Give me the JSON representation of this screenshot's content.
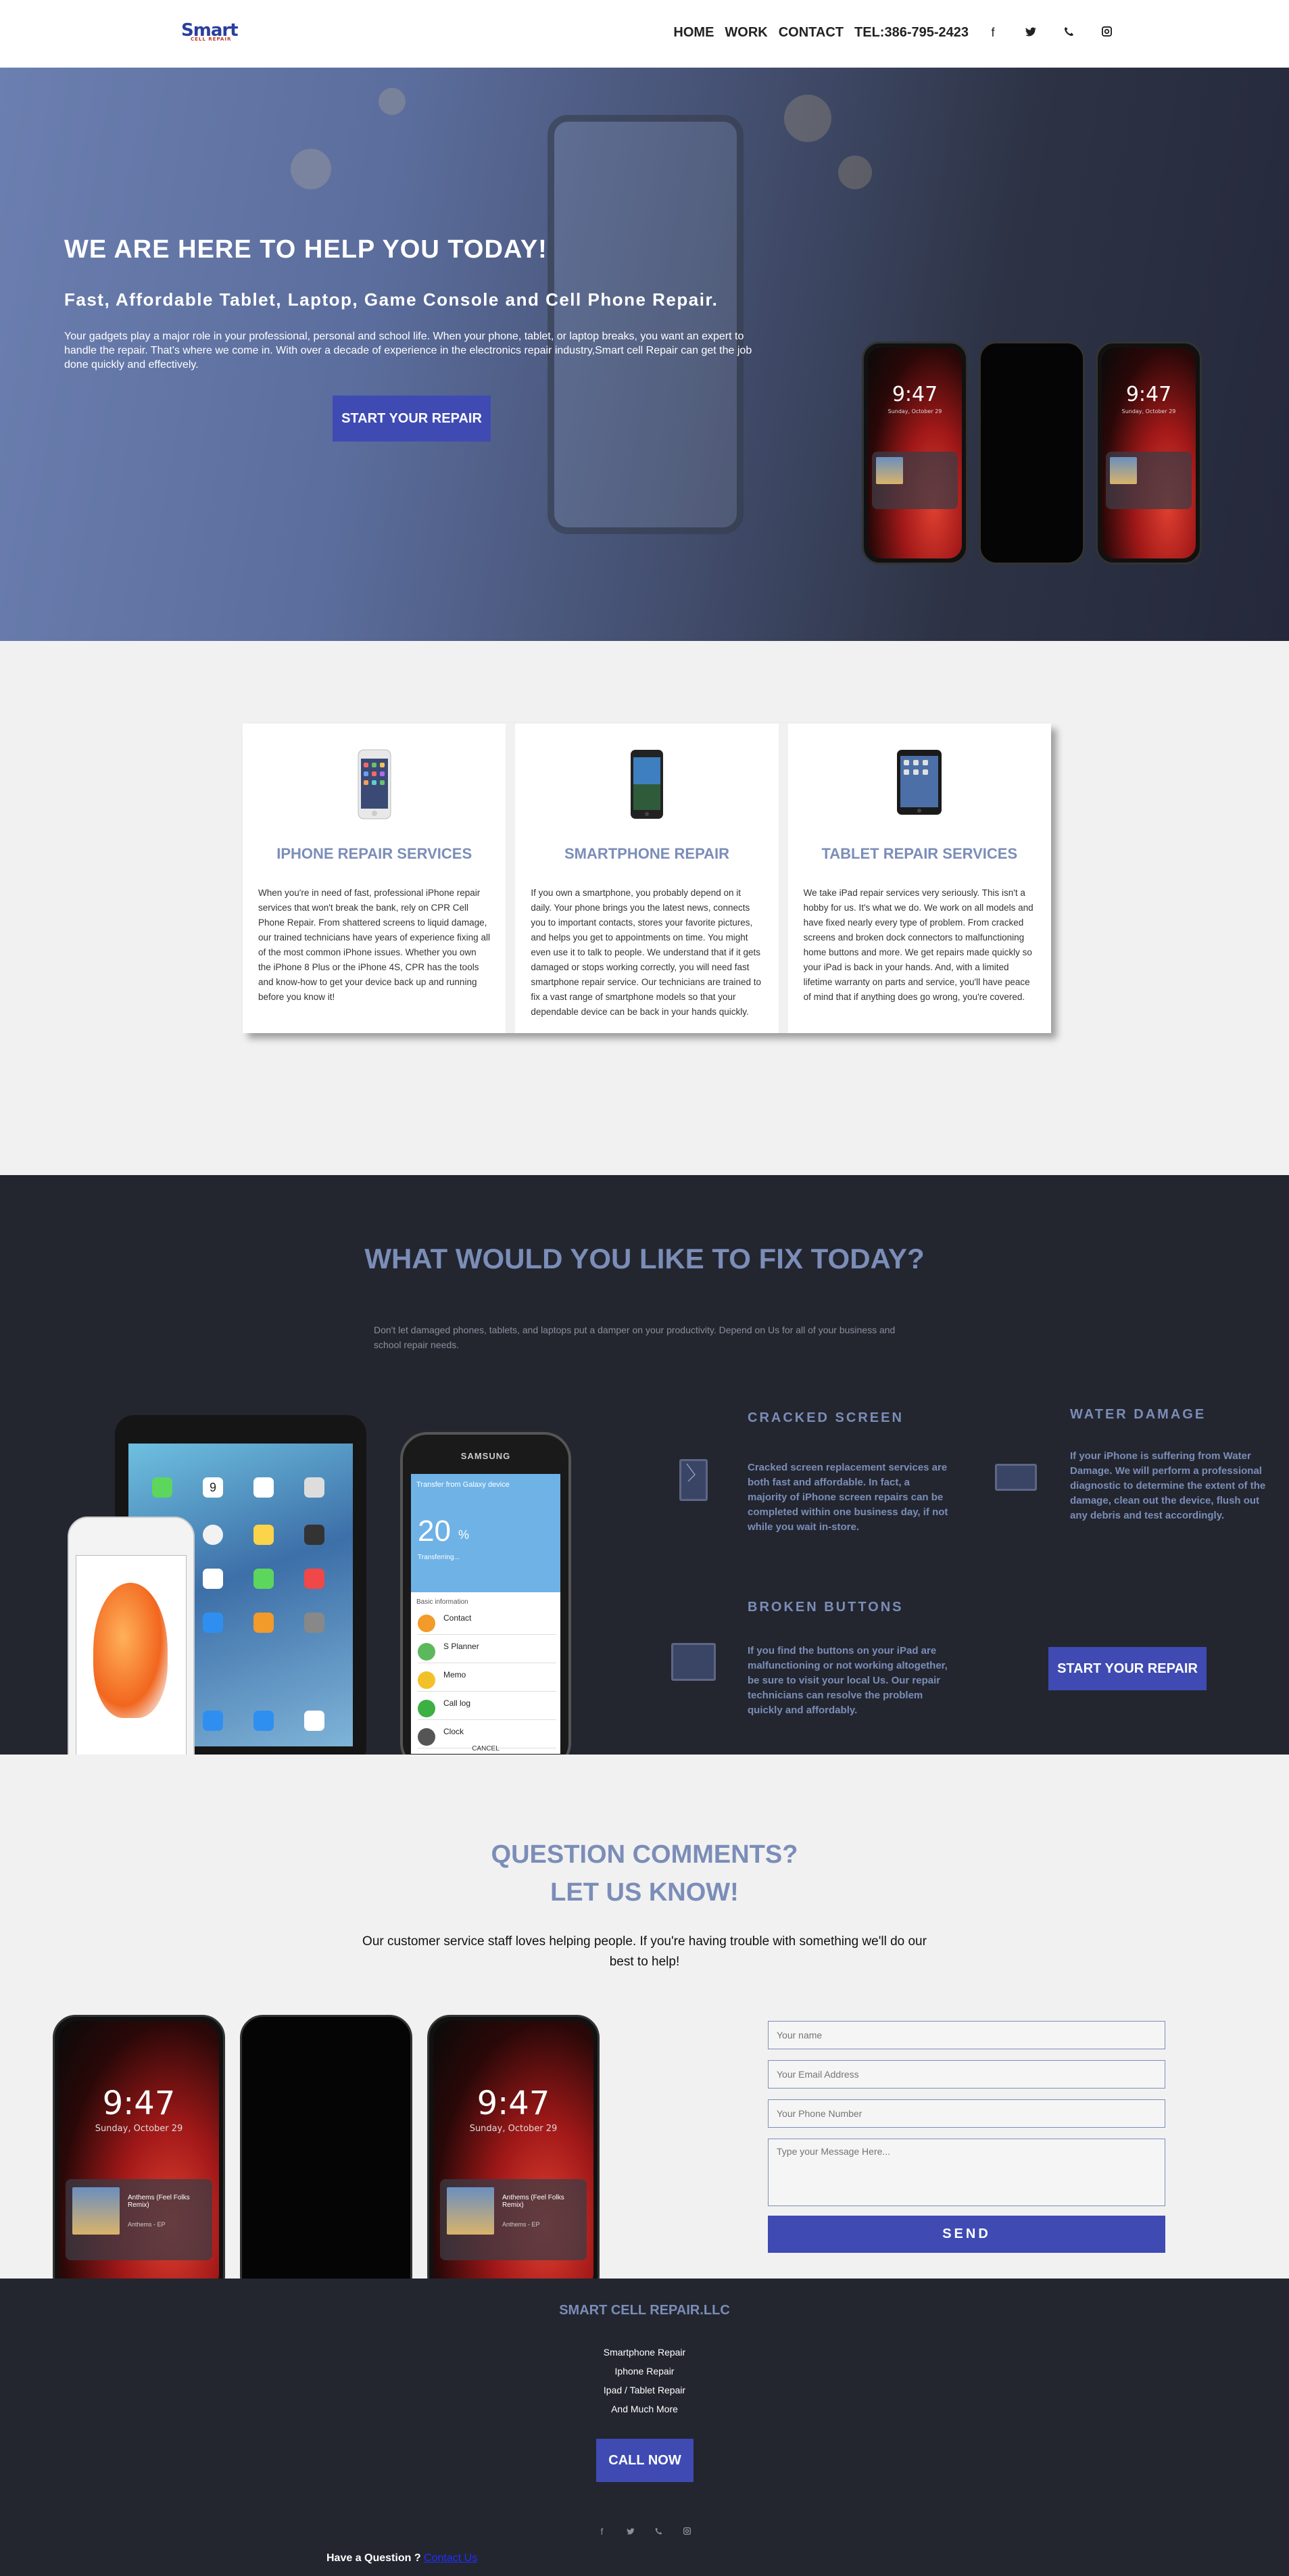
{
  "header": {
    "logo": "Smart",
    "logo_sub": "CELL REPAIR",
    "nav": [
      "HOME",
      "WORK",
      "CONTACT",
      "TEL:386-795-2423"
    ],
    "social_icons": [
      "facebook-icon",
      "twitter-icon",
      "phone-icon",
      "instagram-icon"
    ]
  },
  "hero": {
    "title": "WE ARE HERE TO HELP YOU TODAY!",
    "subtitle": "Fast, Affordable Tablet, Laptop, Game Console and Cell Phone Repair.",
    "text": "Your gadgets play a major role in your professional, personal and school life. When your phone, tablet, or laptop breaks, you want an expert to handle the repair. That's where we come in. With over a decade of experience in the electronics repair industry,Smart cell Repair can get the job done quickly and effectively.",
    "cta": "START YOUR REPAIR",
    "phone_time": "9:47",
    "phone_date": "Sunday, October 29"
  },
  "services": [
    {
      "title": "IPHONE REPAIR SERVICES",
      "icon": "iphone-icon",
      "text": "When you're in need of fast, professional iPhone repair services that won't break the bank, rely on CPR Cell Phone Repair. From shattered screens to liquid damage, our trained technicians have years of experience fixing all of the most common iPhone issues. Whether you own the iPhone 8 Plus or the iPhone 4S, CPR has the tools and know-how to get your device back up and running before you know it!"
    },
    {
      "title": "SMARTPHONE REPAIR",
      "icon": "smartphone-icon",
      "text": "If you own a smartphone, you probably depend on it daily. Your phone brings you the latest news, connects you to important contacts, stores your favorite pictures, and helps you get to appointments on time. You might even use it to talk to people. We understand that if it gets damaged or stops working correctly, you will need fast smartphone repair service. Our technicians are trained to fix a vast range of smartphone models so that your dependable device can be back in your hands quickly."
    },
    {
      "title": "TABLET REPAIR SERVICES",
      "icon": "tablet-icon",
      "text": "We take iPad repair services very seriously. This isn't a hobby for us. It's what we do. We work on all models and have fixed nearly every type of problem. From cracked screens and broken dock connectors to malfunctioning home buttons and more. We get repairs made quickly so your iPad is back in your hands. And, with a limited lifetime warranty on parts and service, you'll have peace of mind that if anything does go wrong, you're covered."
    }
  ],
  "fix": {
    "title": "WHAT WOULD YOU LIKE TO FIX TODAY?",
    "intro": "Don't let damaged phones, tablets, and laptops put a damper on your productivity. Depend on Us for all of your business and school repair needs.",
    "items": [
      {
        "title": "CRACKED SCREEN",
        "icon": "cracked-screen-icon",
        "text": "Cracked screen replacement services are both fast and affordable. In fact, a majority of iPhone screen repairs can be completed within one business day, if not while you wait in-store."
      },
      {
        "title": "WATER DAMAGE",
        "icon": "water-damage-icon",
        "text": "If your iPhone is suffering from Water Damage. We will perform a professional diagnostic to determine the extent of the damage, clean out the device, flush out any debris and test accordingly."
      },
      {
        "title": "BROKEN BUTTONS",
        "icon": "monitor-icon",
        "text": "If you find the buttons on your iPad are malfunctioning or not working altogether, be sure to visit your local Us. Our repair technicians can resolve the problem quickly and affordably."
      }
    ],
    "cta": "START YOUR REPAIR",
    "galaxy_brand": "SAMSUNG",
    "galaxy_header": "Transfer from Galaxy device",
    "galaxy_percent": "20",
    "galaxy_status": "Transferring...",
    "galaxy_section": "Basic information",
    "galaxy_rows": [
      "Contact",
      "S Planner",
      "Memo",
      "Call log",
      "Clock"
    ],
    "galaxy_cancel": "CANCEL",
    "ipad_date": "9"
  },
  "contact": {
    "title_line1": "QUESTION COMMENTS?",
    "title_line2": "LET US KNOW!",
    "lead": "Our customer service staff loves helping people. If you're having trouble with something we'll do our best to help!",
    "placeholders": {
      "name": "Your name",
      "email": "Your Email Address",
      "phone": "Your Phone Number",
      "message": "Type your Message Here..."
    },
    "send": "SEND",
    "phone_time": "9:47",
    "phone_date": "Sunday, October 29",
    "song_title": "Anthems (Feel Folks Remix)",
    "song_artist": "Anthems - EP"
  },
  "footer": {
    "title": "SMART CELL REPAIR.LLC",
    "links": [
      "Smartphone Repair",
      "Iphone Repair",
      "Ipad / Tablet Repair",
      "And Much More"
    ],
    "cta": "CALL NOW",
    "social_icons": [
      "facebook-icon",
      "twitter-icon",
      "phone-icon",
      "instagram-icon"
    ],
    "ask": "Have a Question ?",
    "ask_link": "Contact Us"
  },
  "colors": {
    "accent_blue": "#3f4bb3",
    "heading_blue": "#7b8db8",
    "dark_bg": "#23262f",
    "light_bg": "#f1f1f1"
  }
}
